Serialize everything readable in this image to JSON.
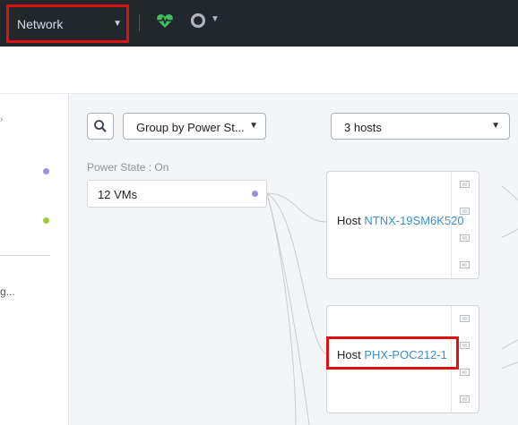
{
  "topbar": {
    "nav_select_label": "Network",
    "health_icon": "heartbeat-icon",
    "status_icon": "circle-icon"
  },
  "toolbar": {
    "group_select_value": "Group by Power St...",
    "hosts_select_value": "3 hosts"
  },
  "groups": [
    {
      "label": "Power State : On",
      "vm_count_label": "12 VMs"
    }
  ],
  "left_panel": {
    "truncated_text": "g..."
  },
  "hosts": [
    {
      "prefix": "Host",
      "name": "NTNX-19SM6K520"
    },
    {
      "prefix": "Host",
      "name": "PHX-POC212-1"
    }
  ],
  "colors": {
    "topbar_bg": "#22272e",
    "highlight": "#e01010",
    "link": "#3d8fd4",
    "health_green": "#3fbf5a",
    "dot_purple": "#9b8fe0",
    "dot_green": "#a6c83a"
  }
}
